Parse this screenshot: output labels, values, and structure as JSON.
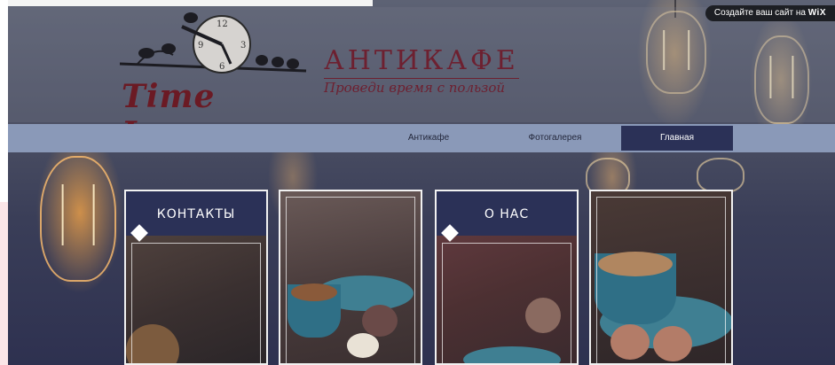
{
  "wix_badge": {
    "text": "Создайте ваш сайт на",
    "brand": "WiX"
  },
  "logo": {
    "text": "Time Lapse",
    "icon": "clock-with-birds-icon"
  },
  "header": {
    "title": "АНТИКАФЕ",
    "subtitle": "Проведи время с пользой"
  },
  "nav": {
    "items": [
      {
        "label": "Антикафе"
      },
      {
        "label": "Фотогалерея"
      },
      {
        "label": "Главная"
      }
    ]
  },
  "cards": [
    {
      "label": "КОНТАКТЫ"
    },
    {
      "label": ""
    },
    {
      "label": "О НАС"
    },
    {
      "label": ""
    }
  ],
  "colors": {
    "accent": "#2b3157",
    "brand": "#6b1a24",
    "navbar": "#8a99b8"
  }
}
